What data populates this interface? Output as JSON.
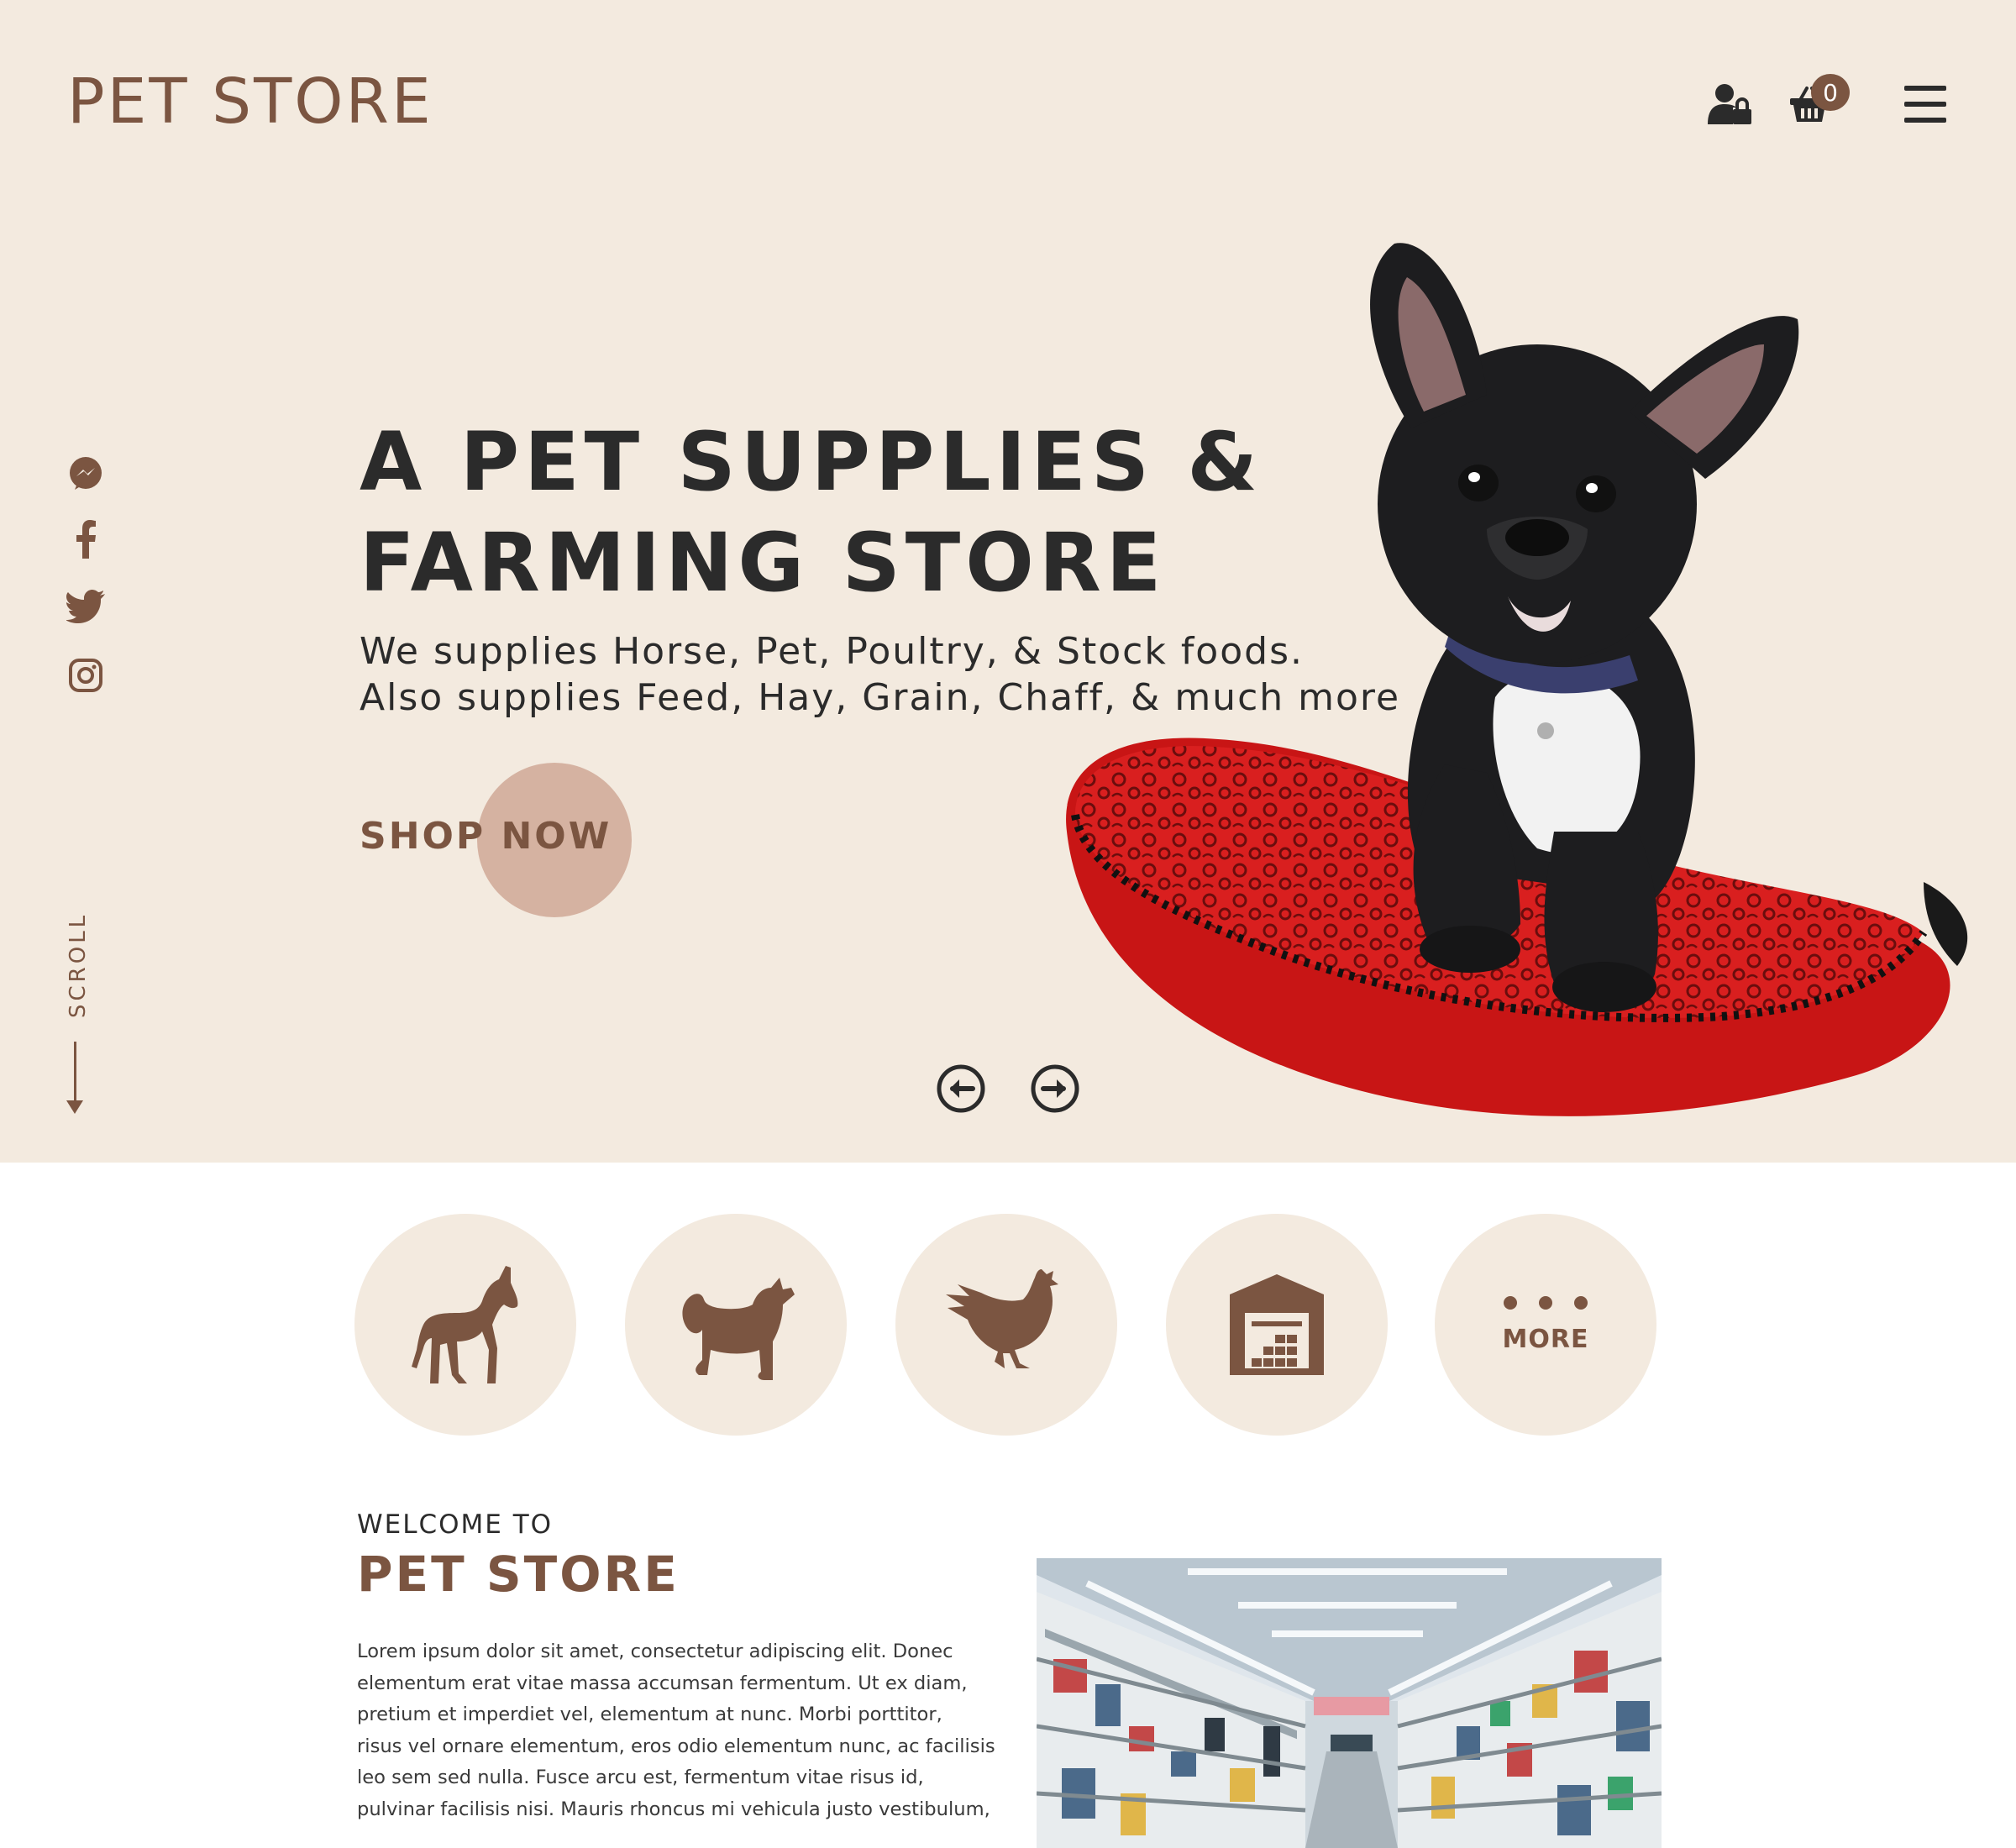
{
  "header": {
    "logo": "PET STORE",
    "cart_count": "0",
    "icons": [
      "user-lock-icon",
      "basket-icon",
      "hamburger-menu-icon"
    ]
  },
  "social": [
    "messenger-icon",
    "facebook-icon",
    "twitter-icon",
    "instagram-icon"
  ],
  "scroll_label": "SCROLL",
  "hero": {
    "headline_line1": "A PET SUPPLIES &",
    "headline_line2": "FARMING STORE",
    "sub_line1": "We supplies Horse, Pet, Poultry, & Stock foods.",
    "sub_line2": "Also supplies Feed, Hay, Grain, Chaff, & much more",
    "cta": "SHOP NOW"
  },
  "carousel": [
    "arrow-left-circle-icon",
    "arrow-right-circle-icon"
  ],
  "categories": {
    "items": [
      "horse-icon",
      "dog-icon",
      "chicken-icon",
      "barn-icon"
    ],
    "more_label": "MORE"
  },
  "about": {
    "kicker": "WELCOME TO",
    "title": "PET STORE",
    "lines": [
      "Lorem ipsum dolor sit amet, consectetur adipiscing elit. Donec",
      "elementum erat vitae massa accumsan fermentum. Ut ex diam,",
      "pretium et imperdiet vel, elementum at nunc. Morbi porttitor,",
      "risus vel ornare elementum, eros odio elementum nunc, ac facilisis",
      "leo sem sed nulla. Fusce arcu est, fermentum vitae risus id,",
      "pulvinar facilisis nisi. Mauris rhoncus mi vehicula justo vestibulum,"
    ]
  },
  "colors": {
    "brand_brown": "#7b5541",
    "hero_bg": "#f3eadf",
    "cta_circle": "#d5b2a1",
    "text_dark": "#2b2b2b"
  }
}
